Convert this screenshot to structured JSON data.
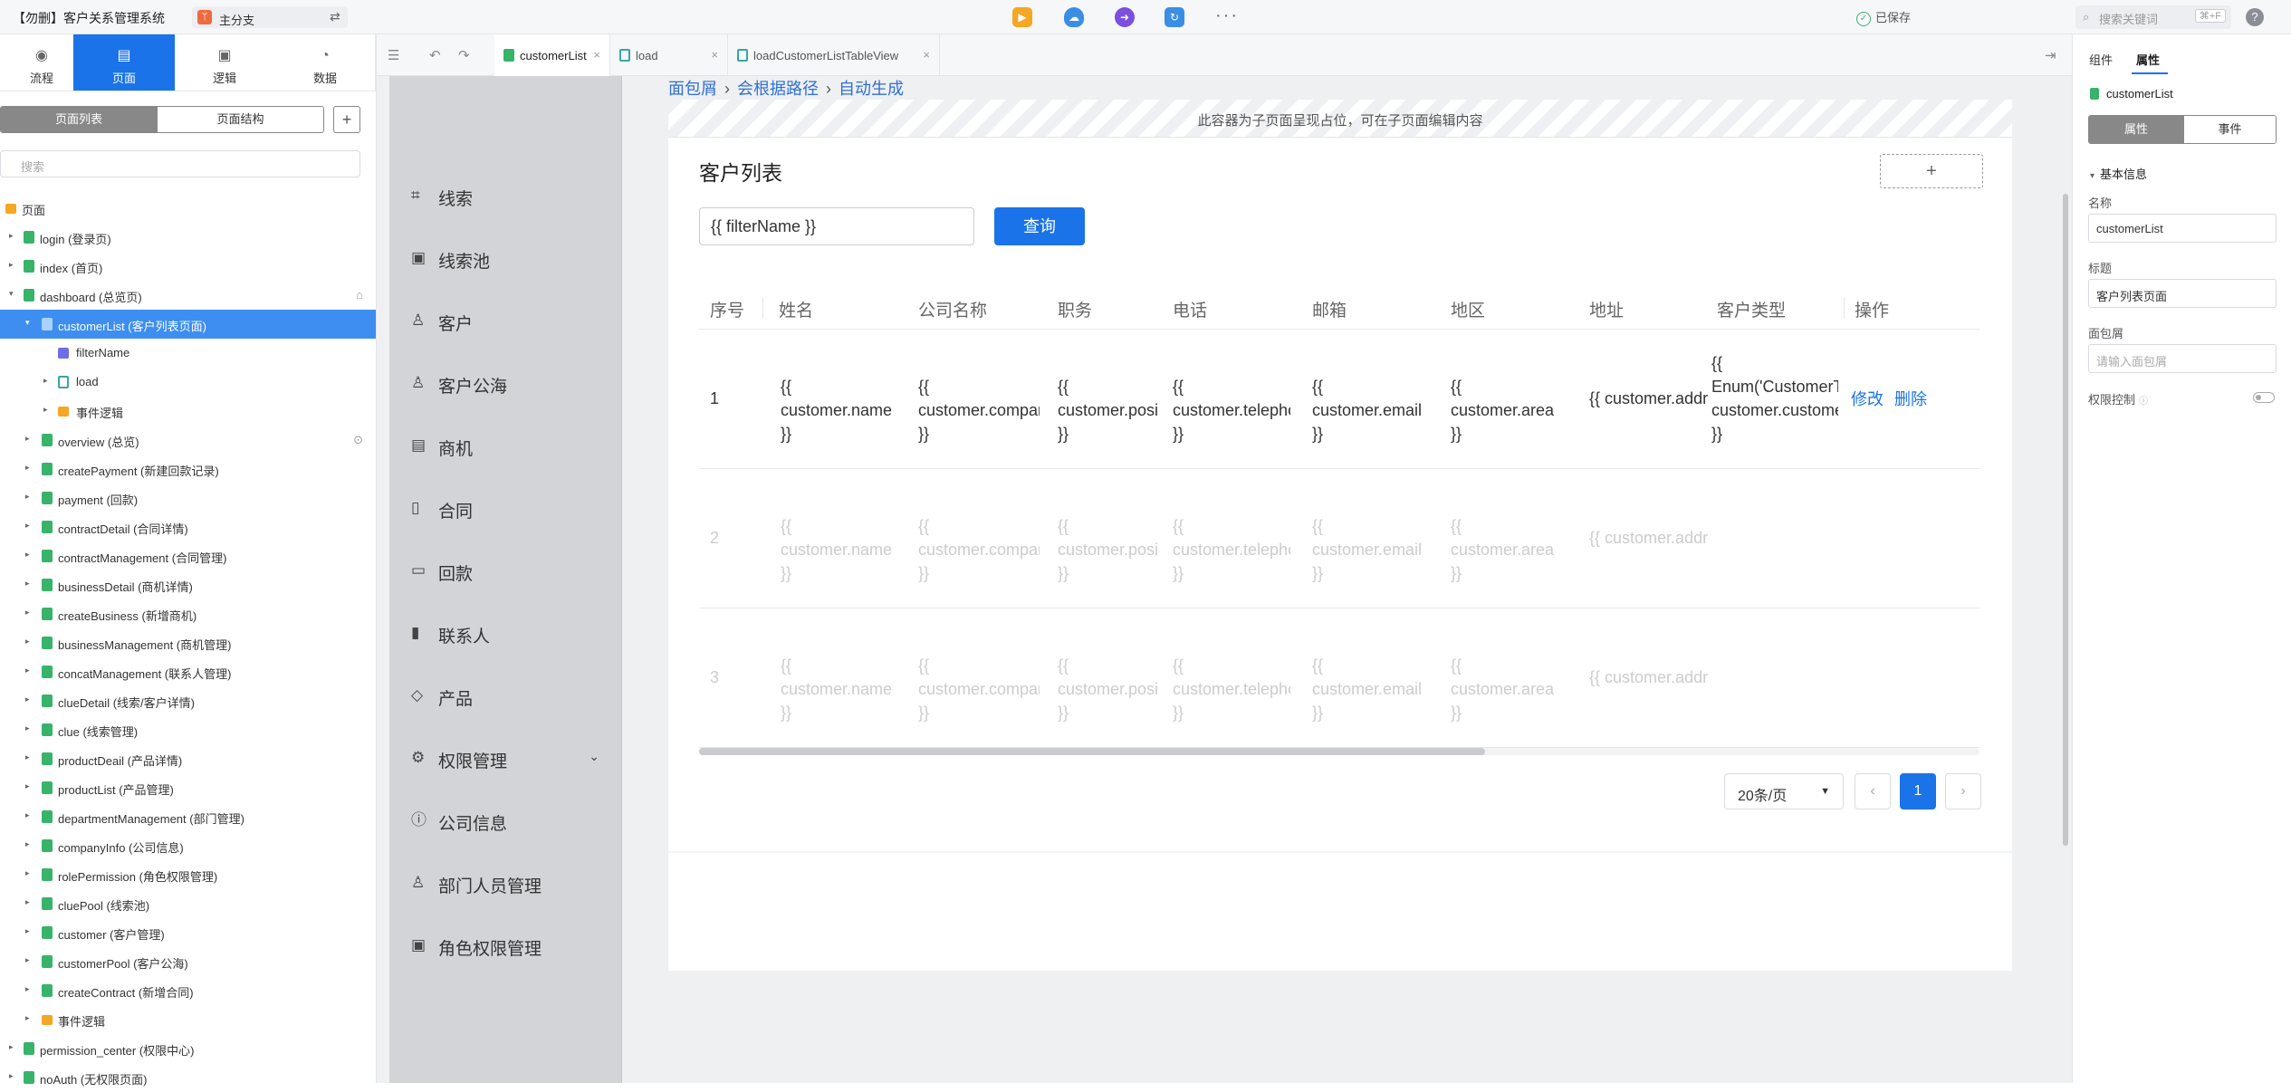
{
  "app": {
    "title": "【勿删】客户关系管理系统",
    "branch": "主分支",
    "saved": "已保存",
    "search_placeholder": "搜索关键词",
    "search_shortcut": "⌘+F"
  },
  "left_tabs": [
    "流程",
    "页面",
    "逻辑",
    "数据"
  ],
  "page_panel": {
    "seg_list": "页面列表",
    "seg_struct": "页面结构",
    "search_placeholder": "搜索"
  },
  "tree": [
    {
      "label": "页面",
      "kind": "folder"
    },
    {
      "label": "login (登录页)",
      "kind": "page"
    },
    {
      "label": "index (首页)",
      "kind": "page"
    },
    {
      "label": "dashboard (总览页)",
      "kind": "page"
    },
    {
      "label": "customerList (客户列表页面)",
      "kind": "page"
    },
    {
      "label": "filterName",
      "kind": "var"
    },
    {
      "label": "load",
      "kind": "logic"
    },
    {
      "label": "事件逻辑",
      "kind": "folder"
    },
    {
      "label": "overview (总览)",
      "kind": "page"
    },
    {
      "label": "createPayment (新建回款记录)",
      "kind": "page"
    },
    {
      "label": "payment (回款)",
      "kind": "page"
    },
    {
      "label": "contractDetail (合同详情)",
      "kind": "page"
    },
    {
      "label": "contractManagement (合同管理)",
      "kind": "page"
    },
    {
      "label": "businessDetail (商机详情)",
      "kind": "page"
    },
    {
      "label": "createBusiness (新增商机)",
      "kind": "page"
    },
    {
      "label": "businessManagement (商机管理)",
      "kind": "page"
    },
    {
      "label": "concatManagement (联系人管理)",
      "kind": "page"
    },
    {
      "label": "clueDetail (线索/客户详情)",
      "kind": "page"
    },
    {
      "label": "clue (线索管理)",
      "kind": "page"
    },
    {
      "label": "productDeail (产品详情)",
      "kind": "page"
    },
    {
      "label": "productList (产品管理)",
      "kind": "page"
    },
    {
      "label": "departmentManagement (部门管理)",
      "kind": "page"
    },
    {
      "label": "companyInfo (公司信息)",
      "kind": "page"
    },
    {
      "label": "rolePermission (角色权限管理)",
      "kind": "page"
    },
    {
      "label": "cluePool (线索池)",
      "kind": "page"
    },
    {
      "label": "customer (客户管理)",
      "kind": "page"
    },
    {
      "label": "customerPool (客户公海)",
      "kind": "page"
    },
    {
      "label": "createContract (新增合同)",
      "kind": "page"
    },
    {
      "label": "事件逻辑",
      "kind": "folder"
    },
    {
      "label": "permission_center (权限中心)",
      "kind": "page"
    },
    {
      "label": "noAuth (无权限页面)",
      "kind": "page"
    }
  ],
  "editor_tabs": [
    "customerList",
    "load",
    "loadCustomerListTableView"
  ],
  "preview_nav": [
    "线索",
    "线索池",
    "客户",
    "客户公海",
    "商机",
    "合同",
    "回款",
    "联系人",
    "产品",
    "权限管理",
    "公司信息",
    "部门人员管理",
    "角色权限管理"
  ],
  "breadcrumb": [
    "面包屑",
    "会根据路径",
    "自动生成"
  ],
  "sub_placeholder": "此容器为子页面呈现占位，可在子页面编辑内容",
  "card": {
    "title": "客户列表",
    "filter_value": "{{ filterName }}",
    "query_label": "查询"
  },
  "table": {
    "headers": [
      "序号",
      "姓名",
      "公司名称",
      "职务",
      "电话",
      "邮箱",
      "地区",
      "地址",
      "客户类型",
      "操作"
    ],
    "rows": [
      {
        "index": "1",
        "name": "{{ customer.name }}",
        "company": "{{ customer.company }}",
        "position": "{{ customer.position }}",
        "telephone": "{{ customer.telephone }}",
        "email": "{{ customer.email }}",
        "area": "{{ customer.area }}",
        "address": "{{ customer.address }}",
        "type": "{{ Enum('CustomerType', customer.customerType) }}",
        "edit": "修改",
        "delete": "删除"
      },
      {
        "index": "2",
        "name": "{{ customer.name }}",
        "company": "{{ customer.company }}",
        "position": "{{ customer.position }}",
        "telephone": "{{ customer.telephone }}",
        "email": "{{ customer.email }}",
        "area": "{{ customer.area }}",
        "address": "{{ customer.address }}"
      },
      {
        "index": "3",
        "name": "{{ customer.name }}",
        "company": "{{ customer.company }}",
        "position": "{{ customer.position }}",
        "telephone": "{{ customer.telephone }}",
        "email": "{{ customer.email }}",
        "area": "{{ customer.area }}",
        "address": "{{ customer.address }}"
      }
    ]
  },
  "pagination": {
    "page_size": "20条/页",
    "current": "1",
    "prev": "‹",
    "next": "›"
  },
  "right_panel": {
    "tab_component": "组件",
    "tab_props": "属性",
    "component_name": "customerList",
    "seg_props": "属性",
    "seg_events": "事件",
    "section": "基本信息",
    "name_label": "名称",
    "name_value": "customerList",
    "title_label": "标题",
    "title_value": "客户列表页面",
    "crumb_label": "面包屑",
    "crumb_placeholder": "请输入面包屑",
    "perm_label": "权限控制"
  },
  "colors": {
    "accent": "#1a73e8",
    "page_icon": "#38b36a",
    "folder_icon": "#f5a623"
  }
}
